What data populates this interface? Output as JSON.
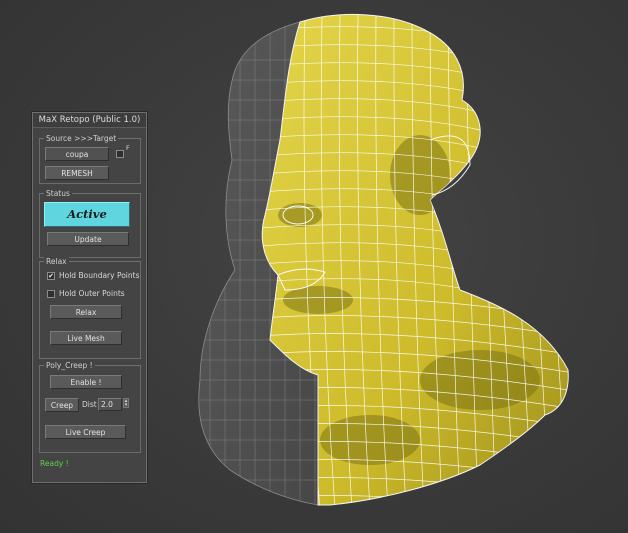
{
  "panel": {
    "title": "MaX Retopo   (Public 1.0)",
    "source_group": {
      "label": "Source >>>Target",
      "source_object": "coupa",
      "flag_label": "F",
      "remesh_button": "REMESH"
    },
    "status_group": {
      "label": "Status",
      "state": "Active",
      "update_button": "Update"
    },
    "relax_group": {
      "label": "Relax",
      "hold_boundary_label": "Hold Boundary Points",
      "hold_boundary_checked": "✔",
      "hold_outer_label": "Hold Outer Points",
      "relax_button": "Relax",
      "live_mesh_button": "Live Mesh"
    },
    "poly_creep_group": {
      "label": "Poly_Creep !",
      "enable_button": "Enable !",
      "creep_button": "Creep",
      "dist_label": "Dist",
      "dist_value": "2.0",
      "live_creep_button": "Live Creep"
    },
    "status_text": "Ready !",
    "status_color": "#5fd04a",
    "active_color": "#5fd5df"
  },
  "viewport": {
    "mesh_color": "#d8c93a",
    "wire_color": "#ffffff",
    "ghost_color": "#9a9a9a",
    "icon": "3d-head-retopology-mesh"
  }
}
